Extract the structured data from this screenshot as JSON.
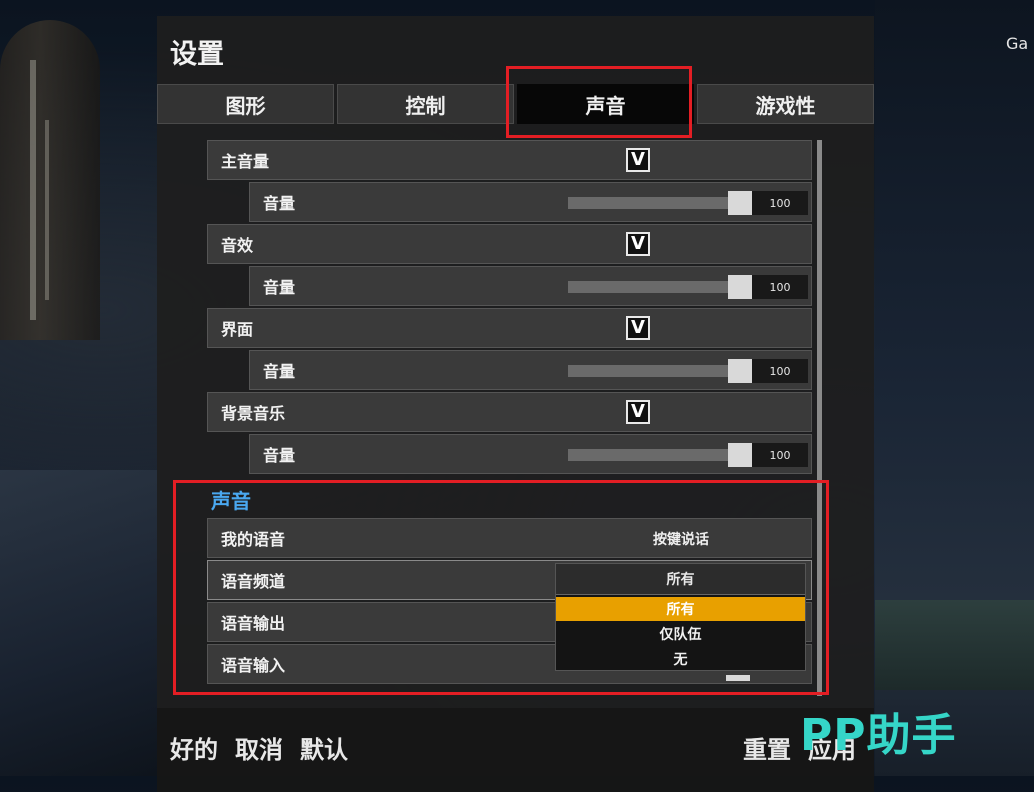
{
  "header": {
    "title": "设置"
  },
  "corner_text": "Ga",
  "tabs": [
    {
      "label": "图形",
      "active": false
    },
    {
      "label": "控制",
      "active": false
    },
    {
      "label": "声音",
      "active": true
    },
    {
      "label": "游戏性",
      "active": false
    }
  ],
  "audio_groups": [
    {
      "label": "主音量",
      "enabled": true,
      "check": "V",
      "volume_label": "音量",
      "volume": 100
    },
    {
      "label": "音效",
      "enabled": true,
      "check": "V",
      "volume_label": "音量",
      "volume": 100
    },
    {
      "label": "界面",
      "enabled": true,
      "check": "V",
      "volume_label": "音量",
      "volume": 100
    },
    {
      "label": "背景音乐",
      "enabled": true,
      "check": "V",
      "volume_label": "音量",
      "volume": 100
    }
  ],
  "voice_section": {
    "title": "声音",
    "my_voice": {
      "label": "我的语音",
      "value": "按键说话"
    },
    "voice_channel": {
      "label": "语音频道",
      "selected": "所有",
      "options": [
        "所有",
        "仅队伍",
        "无"
      ],
      "highlighted": "所有"
    },
    "voice_output": {
      "label": "语音输出"
    },
    "voice_input": {
      "label": "语音输入"
    }
  },
  "footer": {
    "ok": "好的",
    "cancel": "取消",
    "default": "默认",
    "reset": "重置",
    "apply": "应用"
  },
  "watermark": "PP助手",
  "colors": {
    "highlight_box": "#e31e24",
    "section_title": "#4aa8f0",
    "dropdown_highlight": "#e8a000",
    "watermark": "#35d6c8"
  }
}
